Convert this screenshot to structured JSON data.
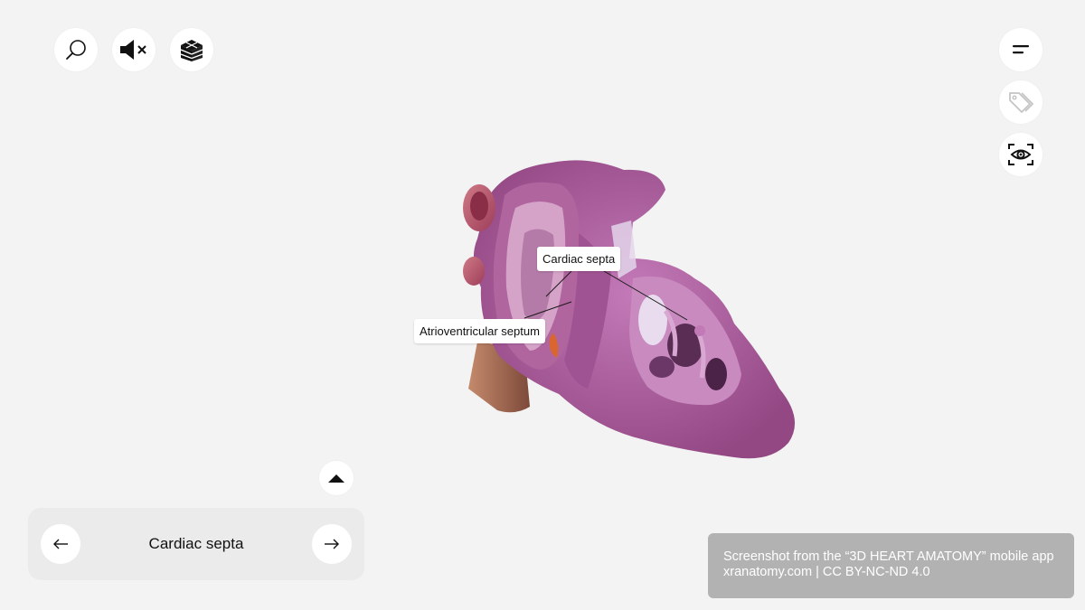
{
  "toolbar_left": {
    "search": {
      "icon": "search-icon"
    },
    "sound": {
      "icon": "mute-icon"
    },
    "layers": {
      "icon": "layers-icon"
    }
  },
  "toolbar_right": {
    "menu": {
      "icon": "menu-icon"
    },
    "labels": {
      "icon": "tag-icon"
    },
    "view": {
      "icon": "eye-focus-icon"
    }
  },
  "model": {
    "name": "heart-cross-section",
    "colors": {
      "muscle": "#a0508f",
      "highlight": "#c77fbf",
      "vessel": "#c0566e",
      "inner": "#e8c6e3"
    }
  },
  "annotations": [
    {
      "text": "Cardiac septa"
    },
    {
      "text": "Atrioventricular septum"
    }
  ],
  "bottom_nav": {
    "title": "Cardiac septa",
    "prev_icon": "arrow-left-icon",
    "next_icon": "arrow-right-icon",
    "expand_icon": "caret-up-icon"
  },
  "credit": {
    "line1": "Screenshot from the “3D HEART AMATOMY” mobile app",
    "line2": "xranatomy.com | CC BY-NC-ND 4.0"
  }
}
